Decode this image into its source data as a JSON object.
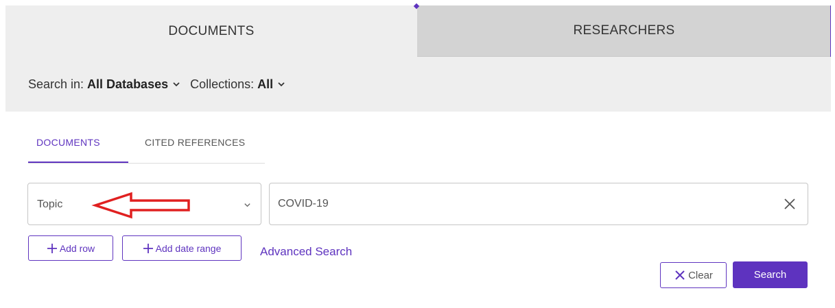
{
  "top_tabs": {
    "documents": "DOCUMENTS",
    "researchers": "RESEARCHERS"
  },
  "search_in": {
    "label": "Search in:",
    "value": "All Databases",
    "collections_label": "Collections:",
    "collections_value": "All"
  },
  "sub_tabs": {
    "documents": "DOCUMENTS",
    "cited_references": "CITED REFERENCES"
  },
  "query_row": {
    "field_value": "Topic",
    "query_value": "COVID-19"
  },
  "actions": {
    "add_row": "Add row",
    "add_date_range": "Add date range",
    "advanced_search": "Advanced Search",
    "clear": "Clear",
    "search": "Search"
  },
  "icons": {
    "chevron": "chevron-down-icon",
    "plus": "plus-icon",
    "close": "close-icon",
    "annotation_arrow": "red-arrow-annotation"
  },
  "colors": {
    "accent": "#5e33bf",
    "annotation": "#e02020",
    "tab_active_bg": "#eeeeee",
    "tab_inactive_bg": "#d3d3d3"
  }
}
